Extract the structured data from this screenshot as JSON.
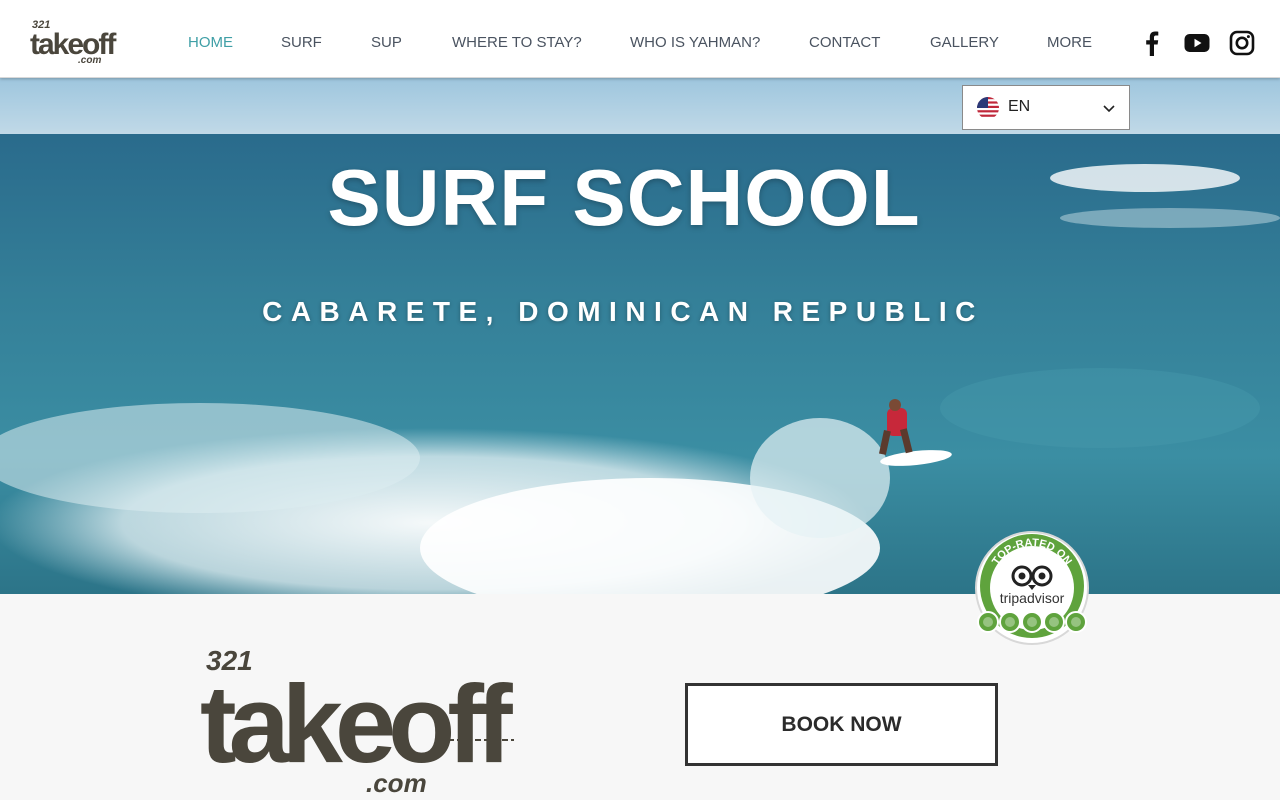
{
  "header": {
    "logo_alt": "321 takeoff .com",
    "nav": [
      {
        "label": "HOME",
        "active": true
      },
      {
        "label": "SURF",
        "active": false
      },
      {
        "label": "SUP",
        "active": false
      },
      {
        "label": "WHERE TO STAY?",
        "active": false
      },
      {
        "label": "WHO IS YAHMAN?",
        "active": false
      },
      {
        "label": "CONTACT",
        "active": false
      },
      {
        "label": "GALLERY",
        "active": false
      },
      {
        "label": "MORE",
        "active": false
      }
    ],
    "social": [
      "facebook-icon",
      "youtube-icon",
      "instagram-icon"
    ]
  },
  "language": {
    "code": "EN",
    "flag": "us-flag-icon"
  },
  "hero": {
    "title": "SURF SCHOOL",
    "subtitle": "CABARETE, DOMINICAN REPUBLIC"
  },
  "badge": {
    "top_text": "TOP-RATED ON",
    "brand": "tripadvisor"
  },
  "lower": {
    "logo_top": "321",
    "logo_main": "takeoff",
    "logo_suffix": ".com",
    "book_button": "BOOK NOW"
  },
  "colors": {
    "nav_active": "#3f9fa6",
    "nav_text": "#4a5360",
    "ocean": "#2f7f96",
    "trip_green": "#5fa33d"
  }
}
